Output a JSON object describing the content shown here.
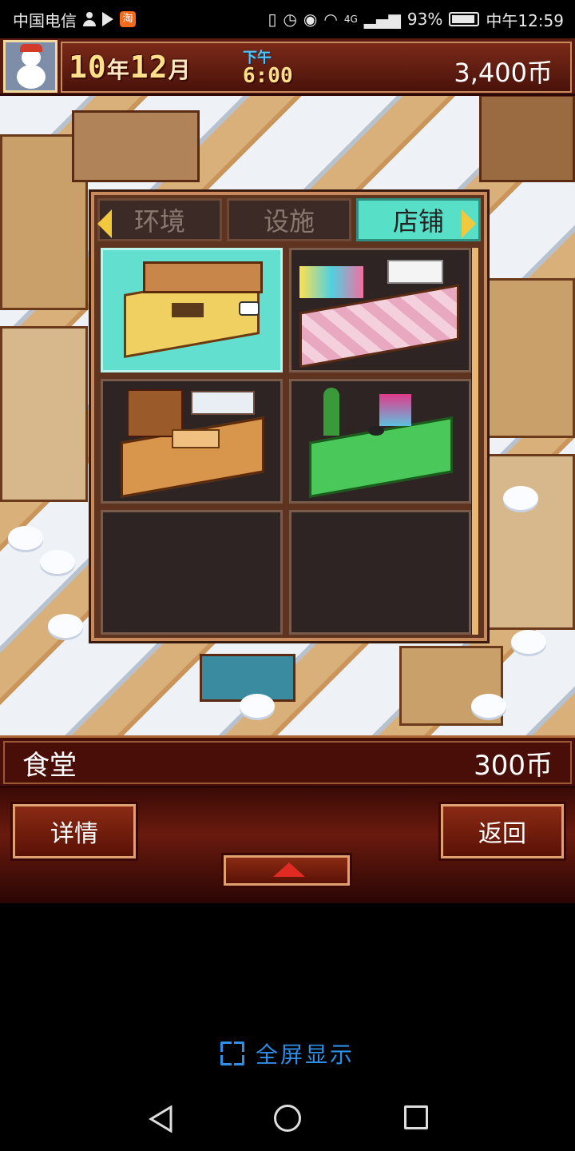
{
  "status_bar": {
    "carrier": "中国电信",
    "battery": "93%",
    "network": "4G",
    "time": "中午12:59"
  },
  "hud": {
    "year": "10",
    "year_unit": "年",
    "month": "12",
    "month_unit": "月",
    "ampm": "下午",
    "clock": "6:00",
    "money": "3,400币"
  },
  "popup": {
    "tabs": [
      {
        "label": "环境",
        "active": false
      },
      {
        "label": "设施",
        "active": false
      },
      {
        "label": "店铺",
        "active": true
      }
    ],
    "cells": [
      {
        "name": "dining-room",
        "selected": true
      },
      {
        "name": "souvenir-shop",
        "selected": false
      },
      {
        "name": "library-room",
        "selected": false
      },
      {
        "name": "plant-shop",
        "selected": false
      },
      {
        "name": "empty",
        "selected": false
      },
      {
        "name": "empty",
        "selected": false
      }
    ]
  },
  "info": {
    "name": "食堂",
    "price": "300币"
  },
  "buttons": {
    "details": "详情",
    "back": "返回"
  },
  "fullscreen_label": "全屏显示",
  "colors": {
    "accent_tab": "#57dfc8",
    "hud_bg": "#5a1a10",
    "fullscreen": "#2e8fe8"
  }
}
